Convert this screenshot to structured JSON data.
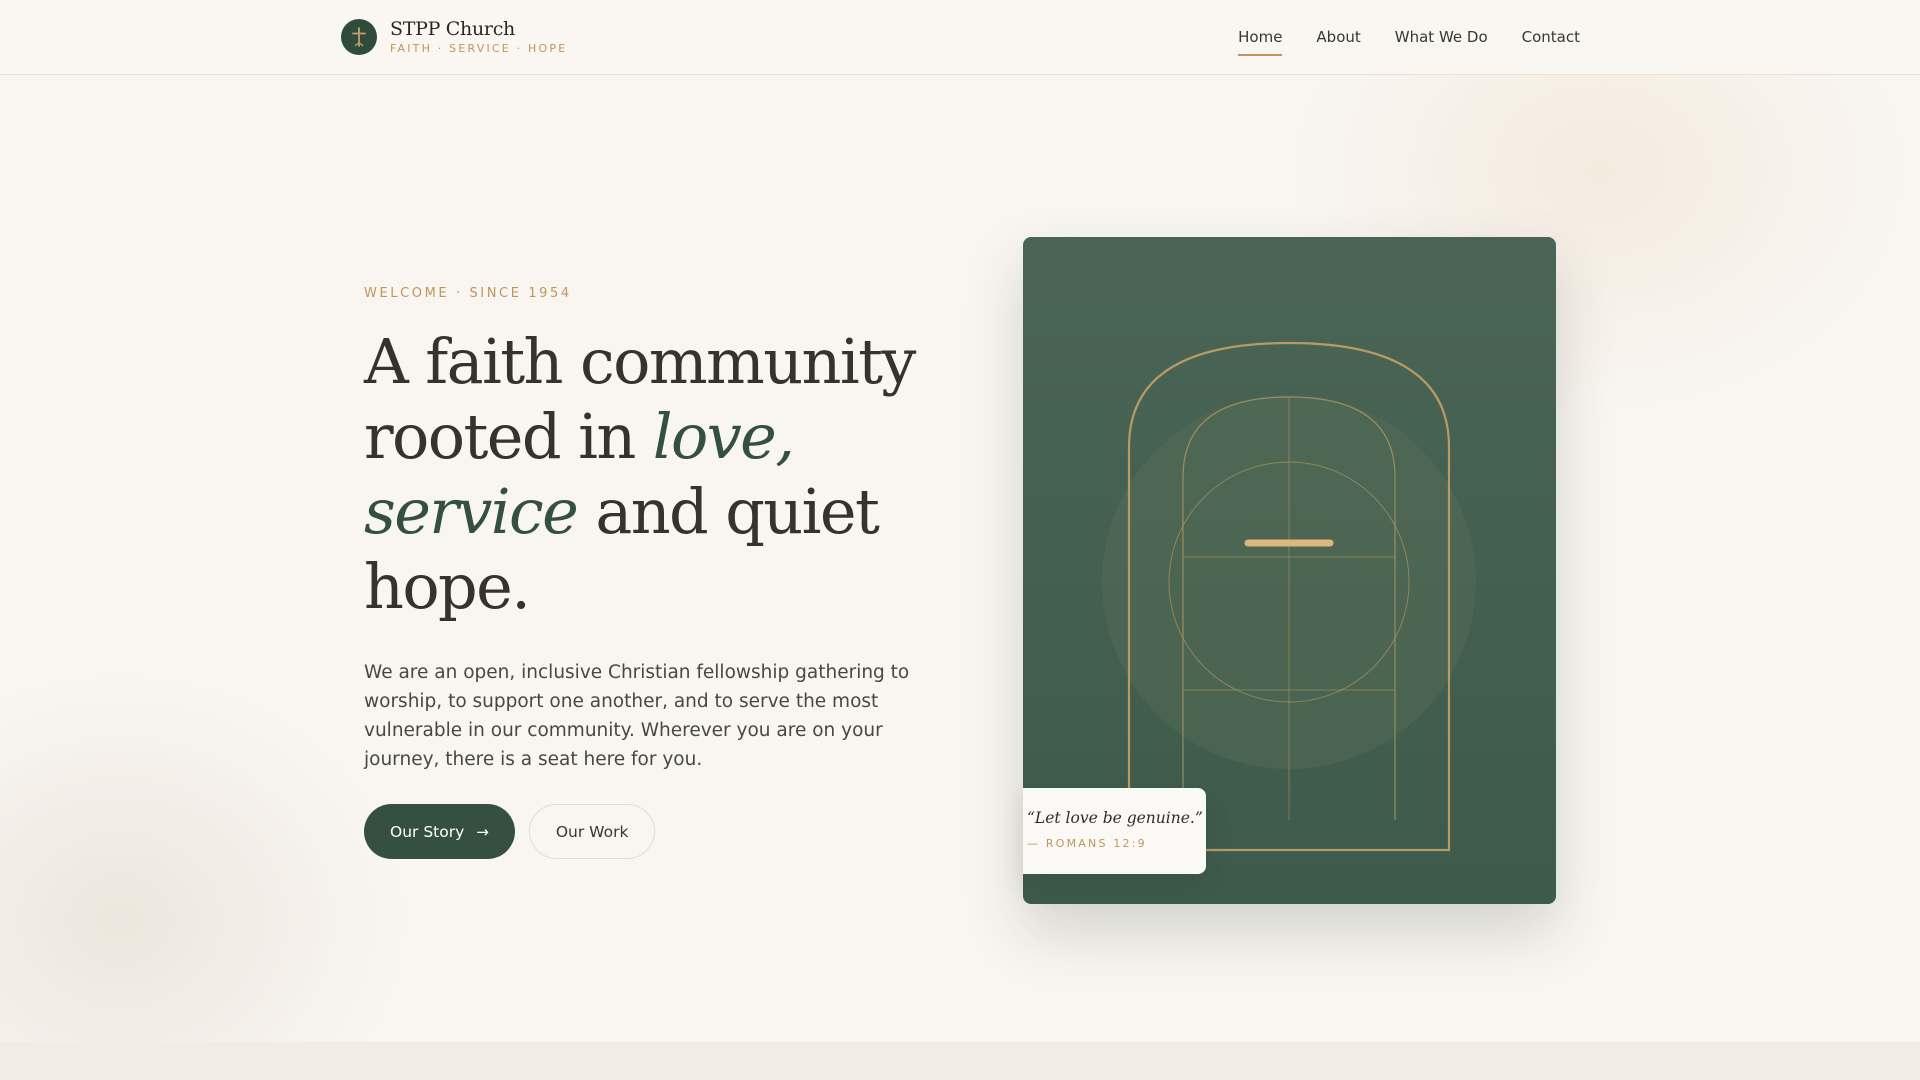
{
  "header": {
    "brand_name": "STPP Church",
    "brand_tagline": "FAITH · SERVICE · HOPE",
    "logo_icon": "cross-icon",
    "nav": [
      {
        "label": "Home",
        "active": true
      },
      {
        "label": "About",
        "active": false
      },
      {
        "label": "What We Do",
        "active": false
      },
      {
        "label": "Contact",
        "active": false
      }
    ]
  },
  "hero": {
    "eyebrow": "WELCOME · SINCE 1954",
    "headline": {
      "part1": "A faith community rooted in ",
      "em1": "love,",
      "part2": " ",
      "em2": "service",
      "part3": " and quiet hope."
    },
    "intro": "We are an open, inclusive Christian fellowship gathering to worship, to support one another, and to serve the most vulnerable in our community. Wherever you are on your journey, there is a seat here for you.",
    "primary_button": "Our Story",
    "primary_button_icon": "arrow-right-icon",
    "primary_button_arrow": "→",
    "secondary_button": "Our Work"
  },
  "feature_card": {
    "illustration": "arched-window-cross-icon",
    "quote": "“Let love be genuine.”",
    "reference": "— ROMANS 12:9"
  },
  "colors": {
    "background": "#f9f6f1",
    "accent_gold": "#c0955a",
    "brand_green": "#36503f",
    "text_dark": "#36332e"
  }
}
